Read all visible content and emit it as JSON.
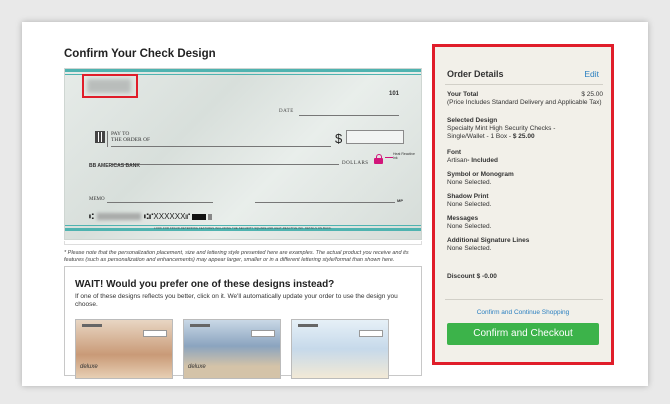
{
  "page": {
    "title": "Confirm Your Check Design",
    "disclaimer": "* Please note that the personalization placement, size and lettering style presented here are examples. The actual product you receive and its features (such as personalization and enhancements) may appear larger, smaller or in a different lettering style/format than shown here."
  },
  "check": {
    "number": "101",
    "date_label": "DATE",
    "pay_label_1": "PAY TO",
    "pay_label_2": "THE ORDER OF",
    "dollar_sign": "$",
    "dollars_label": "DOLLARS",
    "heat_label": "Heat Reactive Ink",
    "bank": "BB AMERICAS BANK",
    "memo_label": "MEMO",
    "mp_label": "MP",
    "micr_prefix": "⑆",
    "micr_mid": "⑆⑈XXXXXX⑈",
    "fraud_text": "LOOK FOR FRAUD-DETERRING FEATURES INCLUDING THE SECURITY SQUARE AND HEAT-REACTIVE INK. DETAILS ON BACK."
  },
  "wait": {
    "heading": "WAIT! Would you prefer one of these designs instead?",
    "text": "If one of these designs reflects you better, click on it. We'll automatically update your order to use the design you choose.",
    "brand": "deluxe"
  },
  "order": {
    "title": "Order Details",
    "edit": "Edit",
    "total_label": "Your Total",
    "total_value": "$ 25.00",
    "total_note": "(Price Includes Standard Delivery and Applicable Tax)",
    "design_label": "Selected Design",
    "design_value_1": "Specialty Mint High Security Checks -",
    "design_value_2": "Single/Wallet - 1 Box -",
    "design_price": "$ 25.00",
    "font_label": "Font",
    "font_value": "Artisan",
    "font_included": "- Included",
    "symbol_label": "Symbol or Monogram",
    "symbol_value": "None Selected.",
    "shadow_label": "Shadow Print",
    "shadow_value": "None Selected.",
    "messages_label": "Messages",
    "messages_value": "None Selected.",
    "sig_label": "Additional Signature Lines",
    "sig_value": "None Selected.",
    "discount": "Discount $ -0.00",
    "continue": "Confirm and Continue Shopping",
    "checkout": "Confirm and Checkout"
  },
  "colors": {
    "accent_green": "#3cb34a",
    "link_blue": "#2a7fc0",
    "highlight_red": "#e01d2a"
  }
}
